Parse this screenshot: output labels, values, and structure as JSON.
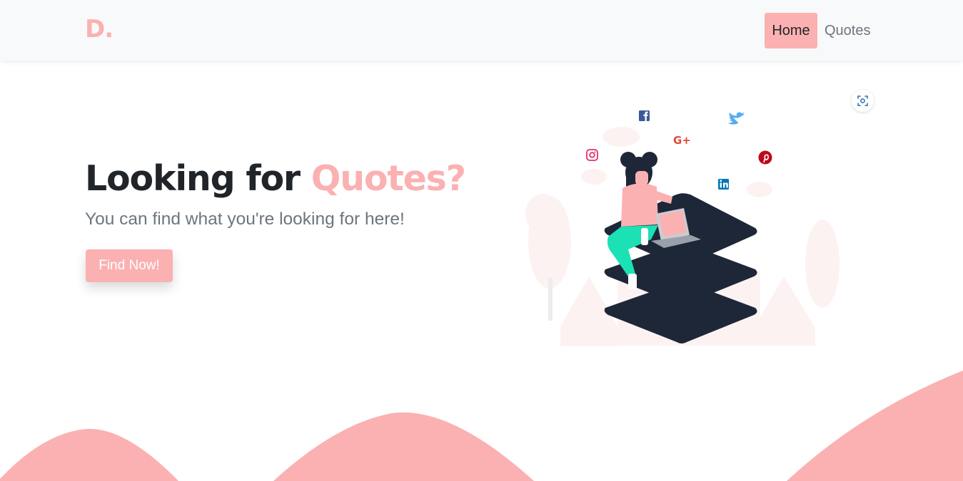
{
  "navbar": {
    "brand": "D.",
    "links": [
      {
        "label": "Home",
        "active": true
      },
      {
        "label": "Quotes",
        "active": false
      }
    ]
  },
  "hero": {
    "title_prefix": "Looking for",
    "title_accent": "Quotes?",
    "subtitle": "You can find what you're looking for here!",
    "cta_label": "Find Now!"
  },
  "illustration": {
    "social_icons": [
      "facebook-icon",
      "twitter-icon",
      "google-plus-icon",
      "instagram-icon",
      "pinterest-icon",
      "linkedin-icon"
    ]
  },
  "colors": {
    "accent": "#fbb1b1",
    "navbar_bg": "#f8f9fa",
    "text_dark": "#212529",
    "text_muted": "#6c757d",
    "illustration_dark": "#1e2738"
  }
}
